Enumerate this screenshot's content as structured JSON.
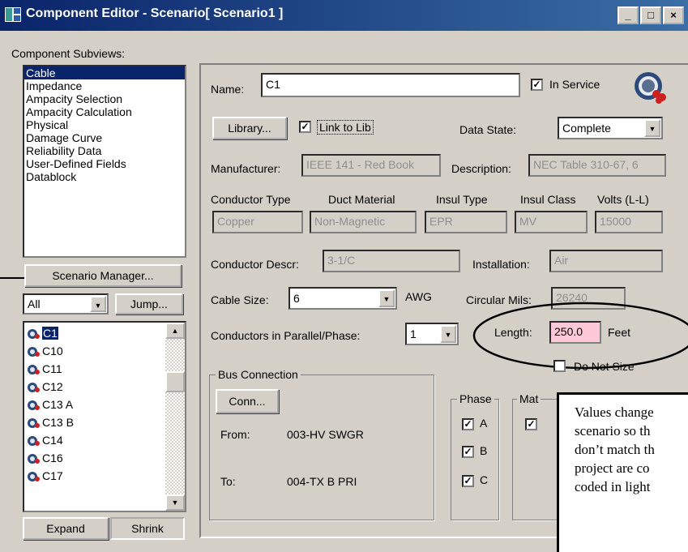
{
  "window": {
    "title": "Component Editor  - Scenario[ Scenario1 ]",
    "min_label": "_",
    "max_label": "□",
    "close_label": "×"
  },
  "subviews": {
    "label": "Component Subviews:",
    "items": [
      "Cable",
      "Impedance",
      "Ampacity Selection",
      "Ampacity Calculation",
      "Physical",
      "Damage Curve",
      "Reliability Data",
      "User-Defined Fields",
      "Datablock"
    ],
    "selected_index": 0
  },
  "scenario_manager_label": "Scenario Manager...",
  "filter": {
    "value": "All",
    "jump_label": "Jump..."
  },
  "components": {
    "items": [
      "C1",
      "C10",
      "C11",
      "C12",
      "C13 A",
      "C13 B",
      "C14",
      "C16",
      "C17"
    ],
    "selected": "C1"
  },
  "bottom_buttons": {
    "expand": "Expand",
    "shrink": "Shrink"
  },
  "form": {
    "name_label": "Name:",
    "name_value": "C1",
    "in_service_label": "In Service",
    "in_service_checked": true,
    "library_label": "Library...",
    "link_label": "Link to Lib",
    "link_checked": true,
    "data_state_label": "Data State:",
    "data_state_value": "Complete",
    "manufacturer_label": "Manufacturer:",
    "manufacturer_value": "IEEE 141 - Red Book",
    "description_label": "Description:",
    "description_value": "NEC Table 310-67, 6",
    "conductor_type_label": "Conductor Type",
    "duct_material_label": "Duct Material",
    "insul_type_label": "Insul Type",
    "insul_class_label": "Insul Class",
    "volts_label": "Volts (L-L)",
    "conductor_type_value": "Copper",
    "duct_material_value": "Non-Magnetic",
    "insul_type_value": "EPR",
    "insul_class_value": "MV",
    "volts_value": "15000",
    "conductor_descr_label": "Conductor Descr:",
    "conductor_descr_value": "3-1/C",
    "installation_label": "Installation:",
    "installation_value": "Air",
    "cable_size_label": "Cable Size:",
    "cable_size_value": "6",
    "awg_label": "AWG",
    "circular_mils_label": "Circular Mils:",
    "circular_mils_value": "26240",
    "parallel_label": "Conductors in Parallel/Phase:",
    "parallel_value": "1",
    "length_label": "Length:",
    "length_value": "250.0",
    "length_unit": "Feet",
    "do_not_size_label": "Do Not Size",
    "do_not_size_checked": false
  },
  "bus": {
    "label": "Bus Connection",
    "conn_label": "Conn...",
    "from_label": "From:",
    "from_value": "003-HV SWGR",
    "to_label": "To:",
    "to_value": "004-TX B PRI"
  },
  "phase": {
    "label": "Phase",
    "items": [
      "A",
      "B",
      "C"
    ],
    "checked": [
      true,
      true,
      true
    ]
  },
  "mat_group_label": "Mat",
  "callout": {
    "lines": [
      "Values change",
      "scenario so th",
      "don’t match th",
      "project are co",
      "coded in light"
    ]
  },
  "colors": {
    "changed_value_bg": "#ffc8d8",
    "selection": "#0a246a",
    "window_face": "#d4d0c8"
  }
}
